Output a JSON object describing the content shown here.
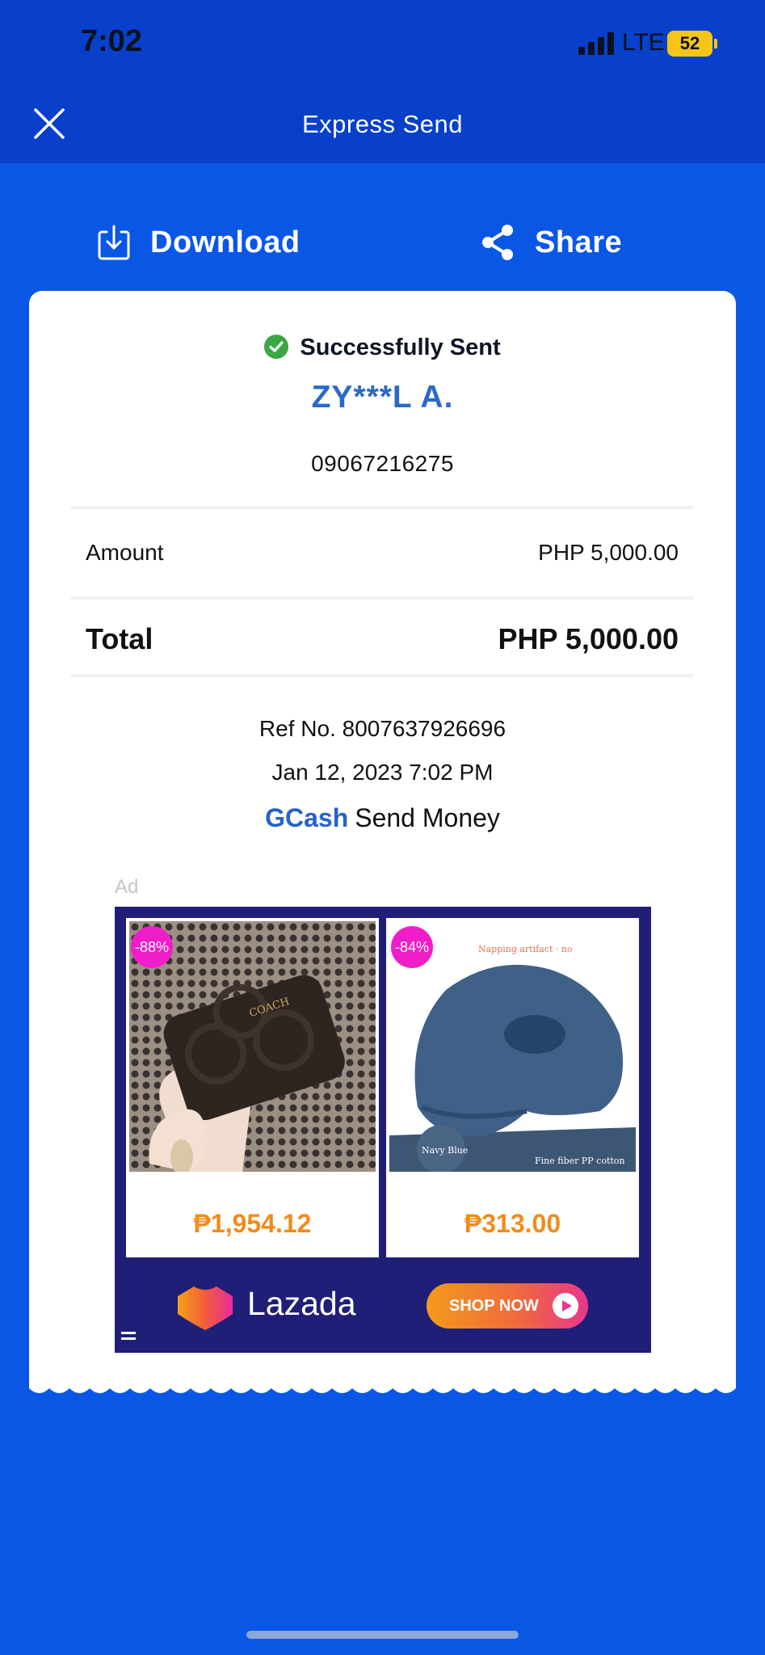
{
  "status_bar": {
    "time": "7:02",
    "network": "LTE",
    "battery": "52"
  },
  "nav": {
    "title": "Express Send"
  },
  "actions": {
    "download": "Download",
    "share": "Share"
  },
  "receipt": {
    "status": "Successfully Sent",
    "recipient_name": "ZY***L A.",
    "recipient_number": "09067216275",
    "amount_label": "Amount",
    "amount_value": "PHP 5,000.00",
    "total_label": "Total",
    "total_value": "PHP 5,000.00",
    "ref": "Ref No. 8007637926696",
    "datetime": "Jan 12, 2023 7:02 PM",
    "service_brand": "GCash",
    "service_name": "Send Money"
  },
  "ad": {
    "label": "Ad",
    "products": [
      {
        "discount": "-88%",
        "price": "₱1,954.12",
        "wallet_brand": "COACH"
      },
      {
        "discount": "-84%",
        "price": "₱313.00",
        "caption_top": "Napping artifact · no",
        "caption_color": "Navy Blue",
        "caption_material": "Fine fiber PP cotton"
      }
    ],
    "brand": "Lazada",
    "cta": "SHOP NOW"
  },
  "colors": {
    "primary": "#0a57e6",
    "header": "#0840c9",
    "success": "#3aa745",
    "accent_text": "#2b69c8",
    "price": "#f08c1c"
  }
}
